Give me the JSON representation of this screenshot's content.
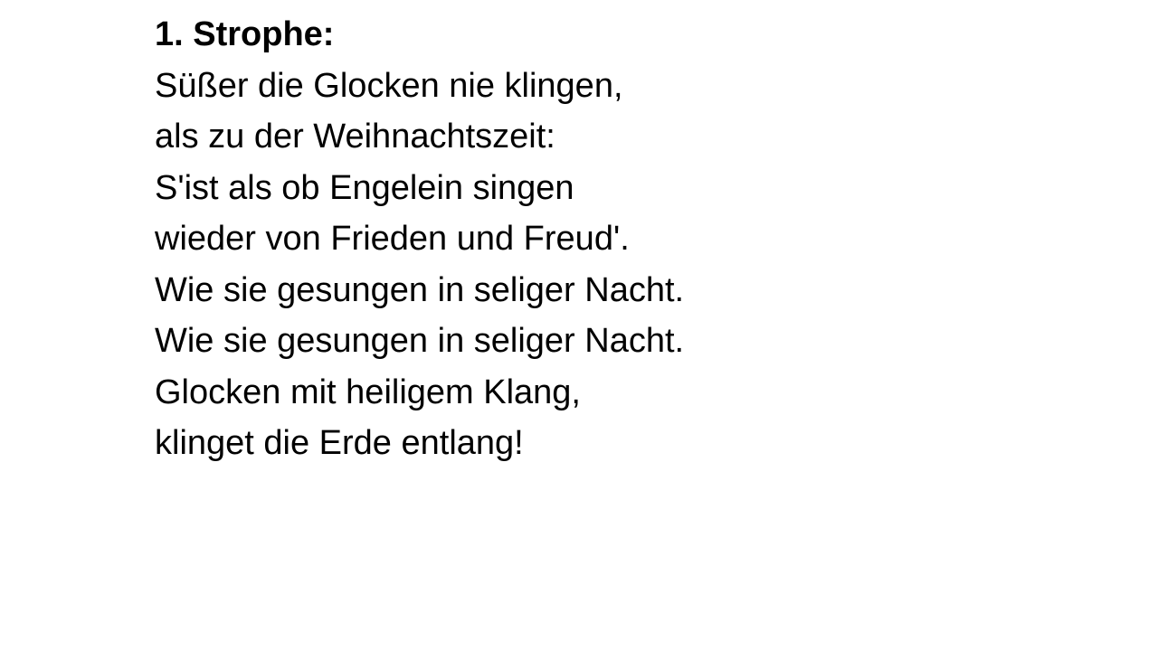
{
  "heading": "1. Strophe:",
  "lines": [
    "Süßer die Glocken nie klingen,",
    "als zu der Weihnachtszeit:",
    "S'ist als ob Engelein singen",
    "wieder von Frieden und Freud'.",
    "Wie sie gesungen in seliger Nacht.",
    "Wie sie gesungen in seliger Nacht.",
    "Glocken mit heiligem Klang,",
    "klinget die Erde entlang!"
  ]
}
